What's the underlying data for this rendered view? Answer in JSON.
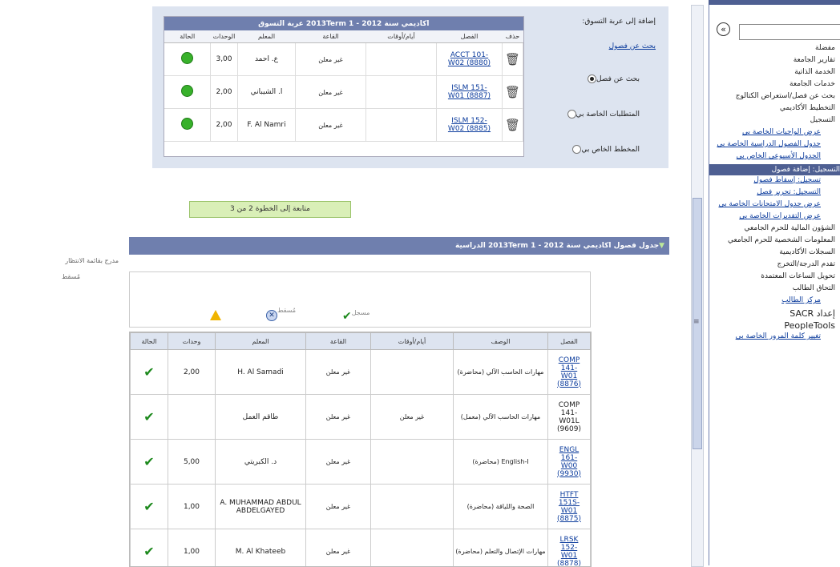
{
  "cart": {
    "side_title": "إضافة إلى عربة التسوق:",
    "search_link": "بحث عن فصول",
    "options": [
      "بحث عن فصل",
      "المتطلبات الخاصة بي",
      "المخطط الخاص بي"
    ],
    "table_title": "اكاديمي سنة 2012 - 1 2013Term عربة التسوق",
    "headers": [
      "حذف",
      "الفصل",
      "أيام/أوقات",
      "القاعة",
      "المعلم",
      "الوحدات",
      "الحالة"
    ],
    "rows": [
      {
        "class": "ACCT 101-W02 (8880)",
        "days": "",
        "room": "غير معلن",
        "instructor": "ع. احمد",
        "units": "3,00"
      },
      {
        "class": "ISLM 151-W01 (8887)",
        "days": "",
        "room": "غير معلن",
        "instructor": "ا. الشيباني",
        "units": "2,00"
      },
      {
        "class": "ISLM 152-W02 (8885)",
        "days": "",
        "room": "غير معلن",
        "instructor": "F. Al Namri",
        "units": "2,00"
      }
    ]
  },
  "next_button": "متابعة إلى الخطوة 2 من 3",
  "schedule": {
    "title": "جدول فصول اكاديمي سنة 2012 - 1 2013Term الدراسية",
    "left_links": [
      "مدرج بقائمة الانتظار",
      "مُسقط"
    ],
    "legend": {
      "enrolled": "مسجل",
      "dropped": "مُسقط"
    },
    "headers": [
      "الفصل",
      "الوصف",
      "أيام/أوقات",
      "القاعة",
      "المعلم",
      "وحدات",
      "الحالة"
    ],
    "rows": [
      {
        "class": "COMP 141-W01 (8876)",
        "link": true,
        "desc": "مهارات الحاسب الآلي (محاضرة)",
        "days": "",
        "room": "غير معلن",
        "instructor": "H. Al Samadi",
        "units": "2,00"
      },
      {
        "class": "COMP 141-W01L (9609)",
        "link": false,
        "desc": "مهارات الحاسب الآلي (معمل)",
        "days": "غير معلن",
        "room": "غير معلن",
        "instructor": "طاقم العمل",
        "units": ""
      },
      {
        "class": "ENGL 161-W00 (9930)",
        "link": true,
        "desc": "English-I (محاضرة)",
        "days": "",
        "room": "غير معلن",
        "instructor": "د. الكبريتي",
        "units": "5,00"
      },
      {
        "class": "HTFT 151S-W01 (8875)",
        "link": true,
        "desc": "الصحة واللياقة (محاضرة)",
        "days": "",
        "room": "غير معلن",
        "instructor": "A. MUHAMMAD ABDUL ABDELGAYED",
        "units": "1,00"
      },
      {
        "class": "LRSK 152-W01 (8878)",
        "link": true,
        "desc": "مهارات الإتصال والتعلم (محاضرة)",
        "days": "",
        "room": "غير معلن",
        "instructor": "M. Al Khateeb",
        "units": "1,00"
      }
    ]
  },
  "nav": {
    "collapse_label": "«",
    "items": [
      {
        "label": "مفضلة",
        "type": "plain"
      },
      {
        "label": "تقارير الجامعة",
        "type": "plain"
      },
      {
        "label": "الخدمة الذاتية",
        "type": "plain"
      },
      {
        "label": "خدمات الجامعة",
        "type": "folder"
      },
      {
        "label": "بحث عن فصل/استعراض الكتالوج",
        "type": "folder"
      },
      {
        "label": "التخطيط الأكاديمي",
        "type": "folder"
      },
      {
        "label": "التسجيل",
        "type": "folder"
      },
      {
        "label": "عرض الواجبات الخاصة بي",
        "type": "sub"
      },
      {
        "label": "جدول الفصول الدراسية الخاصة بي",
        "type": "sub"
      },
      {
        "label": "الجدول الأسبوعي الخاص بي",
        "type": "sub"
      },
      {
        "label": "التسجيل: إضافة فصول",
        "type": "active"
      },
      {
        "label": "تسجيل: إسقاط فصول",
        "type": "sub"
      },
      {
        "label": "التسجيل: تحرير فصل",
        "type": "sub"
      },
      {
        "label": "عرض جدول الامتحانات الخاصة بي",
        "type": "sub"
      },
      {
        "label": "عرض التقديرات الخاصة بي",
        "type": "sub"
      },
      {
        "label": "الشؤون المالية للحرم الجامعي",
        "type": "folder"
      },
      {
        "label": "المعلومات الشخصية للحرم الجامعي",
        "type": "folder"
      },
      {
        "label": "السجلات الأكاديمية",
        "type": "folder"
      },
      {
        "label": "تقدم الدرجة/التخرج",
        "type": "folder"
      },
      {
        "label": "تحويل الساعات المعتمدة",
        "type": "folder"
      },
      {
        "label": "التحاق الطالب",
        "type": "folder"
      },
      {
        "label": "مركز الطالب",
        "type": "sub"
      },
      {
        "label": "إعداد SACR",
        "type": "plain"
      },
      {
        "label": "PeopleTools",
        "type": "plain"
      },
      {
        "label": "تغيير كلمة المرور الخاصة بي",
        "type": "sub"
      }
    ]
  }
}
